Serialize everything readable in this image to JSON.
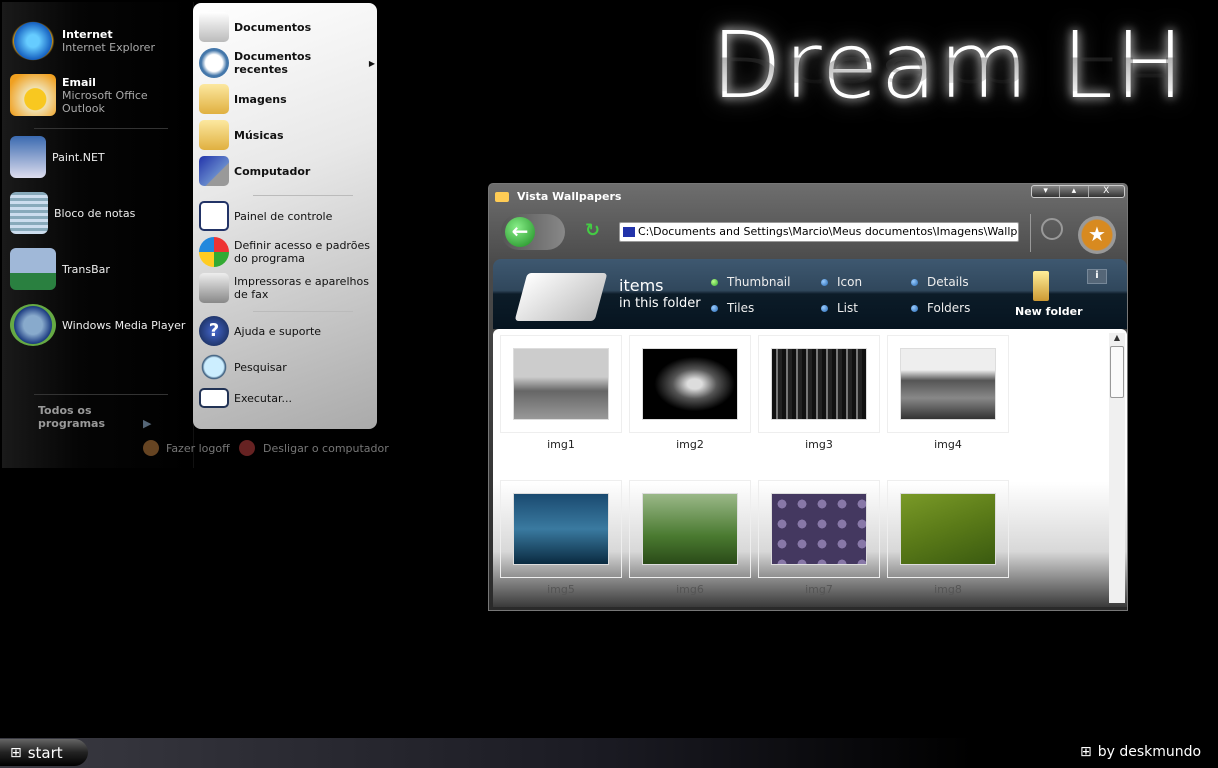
{
  "startmenu": {
    "pinned": [
      {
        "title": "Internet",
        "subtitle": "Internet Explorer",
        "icon": "internet-explorer-icon"
      },
      {
        "title": "Email",
        "subtitle": "Microsoft Office Outlook",
        "icon": "outlook-icon"
      }
    ],
    "recent": [
      {
        "label": "Paint.NET",
        "icon": "paint-net-icon"
      },
      {
        "label": "Bloco de notas",
        "icon": "notepad-icon"
      },
      {
        "label": "TransBar",
        "icon": "transbar-icon"
      },
      {
        "label": "Windows Media Player",
        "icon": "media-player-icon"
      }
    ],
    "all_programs": "Todos os programas",
    "places": [
      {
        "label": "Documentos"
      },
      {
        "label": "Documentos recentes"
      },
      {
        "label": "Imagens"
      },
      {
        "label": "Músicas"
      },
      {
        "label": "Computador"
      }
    ],
    "system": [
      {
        "label": "Painel de controle"
      },
      {
        "label": "Definir acesso e padrões do programa"
      },
      {
        "label": "Impressoras e aparelhos de fax"
      }
    ],
    "help": [
      {
        "label": "Ajuda e suporte"
      },
      {
        "label": "Pesquisar"
      },
      {
        "label": "Executar..."
      }
    ],
    "logoff": "Fazer logoff",
    "shutdown": "Desligar o computador"
  },
  "wallpaper_title": "Dream LH",
  "window": {
    "title": "Vista Wallpapers",
    "controls": [
      "▾",
      "▴",
      "X"
    ],
    "address": "C:\\Documents and Settings\\Marcio\\Meus documentos\\Imagens\\Wallpaper",
    "items_label": "items",
    "in_folder": "in this folder",
    "views": [
      "Thumbnail",
      "Icon",
      "Details",
      "Tiles",
      "List",
      "Folders"
    ],
    "selected_view": "Thumbnail",
    "new_folder": "New folder",
    "files": [
      "img1",
      "img2",
      "img3",
      "img4",
      "img5",
      "img6",
      "img7",
      "img8"
    ]
  },
  "taskbar": {
    "start": "start",
    "credit": "by deskmundo"
  }
}
